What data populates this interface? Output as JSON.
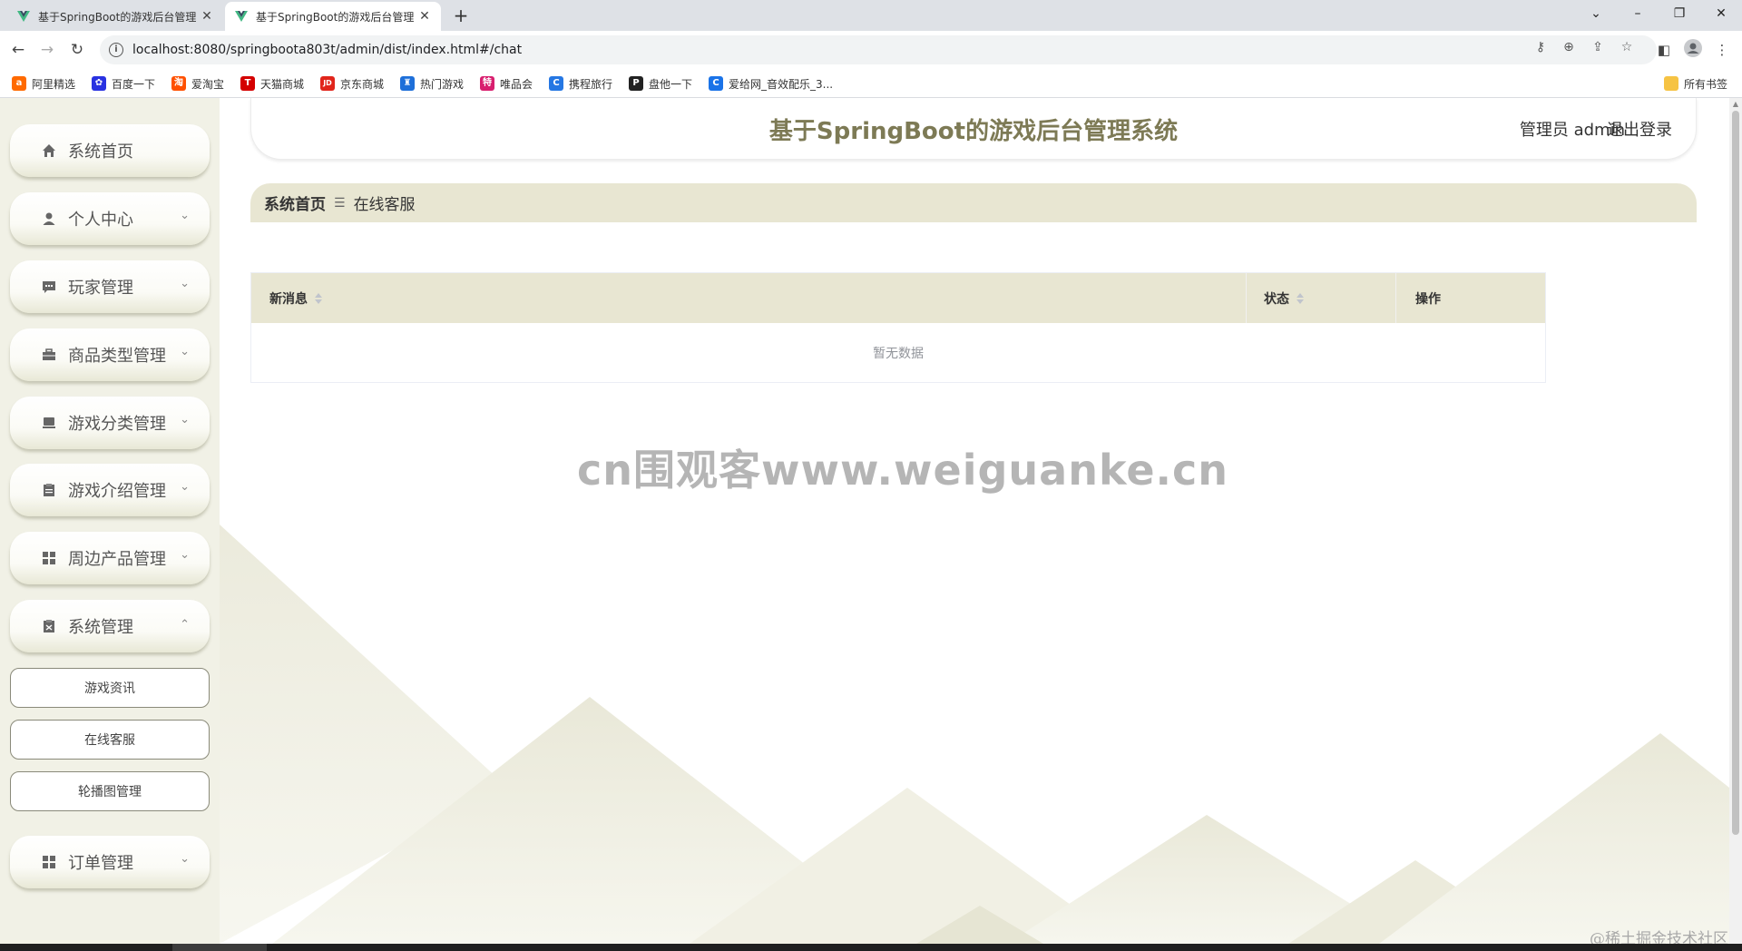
{
  "browser": {
    "tabs": [
      {
        "title": "基于SpringBoot的游戏后台管理",
        "active": false
      },
      {
        "title": "基于SpringBoot的游戏后台管理",
        "active": true
      }
    ],
    "url": "localhost:8080/springboota803t/admin/dist/index.html#/chat",
    "bookmarks": [
      {
        "label": "阿里精选",
        "color": "#ff6a00",
        "glyph": "a"
      },
      {
        "label": "百度一下",
        "color": "#2932e1",
        "glyph": "✿"
      },
      {
        "label": "爱淘宝",
        "color": "#ff5000",
        "glyph": "淘"
      },
      {
        "label": "天猫商城",
        "color": "#d40000",
        "glyph": "T"
      },
      {
        "label": "京东商城",
        "color": "#e1251b",
        "glyph": "JD"
      },
      {
        "label": "热门游戏",
        "color": "#1e6fd9",
        "glyph": "♜"
      },
      {
        "label": "唯品会",
        "color": "#d81e6e",
        "glyph": "特"
      },
      {
        "label": "携程旅行",
        "color": "#2577e3",
        "glyph": "C"
      },
      {
        "label": "盘他一下",
        "color": "#222222",
        "glyph": "P"
      },
      {
        "label": "爱给网_音效配乐_3...",
        "color": "#1a73e8",
        "glyph": "C"
      }
    ],
    "all_bookmarks_label": "所有书签"
  },
  "app": {
    "title": "基于SpringBoot的游戏后台管理系统",
    "user_label": "管理员 admin",
    "logout_label": "退出登录",
    "title_color": "#7d7a55",
    "accent_color": "#e8e6d2"
  },
  "sidebar": {
    "items": [
      {
        "label": "系统首页",
        "icon": "home-icon",
        "has_submenu": false
      },
      {
        "label": "个人中心",
        "icon": "user-icon",
        "has_submenu": true,
        "expanded": false
      },
      {
        "label": "玩家管理",
        "icon": "chat-icon",
        "has_submenu": true,
        "expanded": false
      },
      {
        "label": "商品类型管理",
        "icon": "suitcase-icon",
        "has_submenu": true,
        "expanded": false
      },
      {
        "label": "游戏分类管理",
        "icon": "monitor-icon",
        "has_submenu": true,
        "expanded": false
      },
      {
        "label": "游戏介绍管理",
        "icon": "clipboard-icon",
        "has_submenu": true,
        "expanded": false
      },
      {
        "label": "周边产品管理",
        "icon": "grid-icon",
        "has_submenu": true,
        "expanded": false
      },
      {
        "label": "系统管理",
        "icon": "settings-doc-icon",
        "has_submenu": true,
        "expanded": true
      },
      {
        "label": "订单管理",
        "icon": "grid-icon",
        "has_submenu": true,
        "expanded": false
      }
    ],
    "system_submenu": [
      "游戏资讯",
      "在线客服",
      "轮播图管理"
    ]
  },
  "breadcrumb": {
    "home": "系统首页",
    "current": "在线客服"
  },
  "table": {
    "columns": [
      "新消息",
      "状态",
      "操作"
    ],
    "rows": [],
    "empty_text": "暂无数据"
  },
  "overlay": {
    "watermark": "cn围观客www.weiguanke.cn",
    "corner_mark": "@稀土掘金技术社区"
  }
}
